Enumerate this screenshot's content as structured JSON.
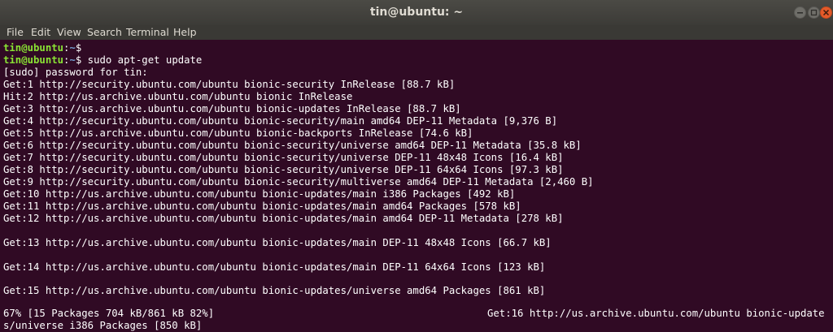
{
  "window": {
    "title": "tin@ubuntu: ~",
    "controls": {
      "minimize_icon": "minimize-icon",
      "maximize_icon": "maximize-icon",
      "close_icon": "close-icon"
    }
  },
  "menu": [
    "File",
    "Edit",
    "View",
    "Search",
    "Terminal",
    "Help"
  ],
  "prompt1": {
    "user": "tin@ubuntu",
    "path": "~",
    "symbol": "$"
  },
  "prompt2": {
    "user": "tin@ubuntu",
    "path": "~",
    "symbol": "$",
    "command": " sudo apt-get update"
  },
  "output": {
    "sudo": "[sudo] password for tin:",
    "get1": "Get:1 http://security.ubuntu.com/ubuntu bionic-security InRelease [88.7 kB]",
    "hit2": "Hit:2 http://us.archive.ubuntu.com/ubuntu bionic InRelease",
    "get3": "Get:3 http://us.archive.ubuntu.com/ubuntu bionic-updates InRelease [88.7 kB]",
    "get4": "Get:4 http://security.ubuntu.com/ubuntu bionic-security/main amd64 DEP-11 Metadata [9,376 B]",
    "get5": "Get:5 http://us.archive.ubuntu.com/ubuntu bionic-backports InRelease [74.6 kB]",
    "get6": "Get:6 http://security.ubuntu.com/ubuntu bionic-security/universe amd64 DEP-11 Metadata [35.8 kB]",
    "get7": "Get:7 http://security.ubuntu.com/ubuntu bionic-security/universe DEP-11 48x48 Icons [16.4 kB]",
    "get8": "Get:8 http://security.ubuntu.com/ubuntu bionic-security/universe DEP-11 64x64 Icons [97.3 kB]",
    "get9": "Get:9 http://security.ubuntu.com/ubuntu bionic-security/multiverse amd64 DEP-11 Metadata [2,460 B]",
    "get10": "Get:10 http://us.archive.ubuntu.com/ubuntu bionic-updates/main i386 Packages [492 kB]",
    "get11": "Get:11 http://us.archive.ubuntu.com/ubuntu bionic-updates/main amd64 Packages [578 kB]",
    "get12": "Get:12 http://us.archive.ubuntu.com/ubuntu bionic-updates/main amd64 DEP-11 Metadata [278 kB]",
    "get13": "Get:13 http://us.archive.ubuntu.com/ubuntu bionic-updates/main DEP-11 48x48 Icons [66.7 kB]",
    "get14": "Get:14 http://us.archive.ubuntu.com/ubuntu bionic-updates/main DEP-11 64x64 Icons [123 kB]",
    "get15": "Get:15 http://us.archive.ubuntu.com/ubuntu bionic-updates/universe amd64 Packages [861 kB]",
    "status_left": "67% [15 Packages 704 kB/861 kB 82%]",
    "status_right": "Get:16 http://us.archive.ubuntu.com/ubuntu bionic-update",
    "status_wrap": "s/universe i386 Packages [850 kB]"
  },
  "colors": {
    "background": "#300a24",
    "user": "#8ae234",
    "path": "#729fcf",
    "text": "#ffffff",
    "close": "#e45a2a"
  }
}
